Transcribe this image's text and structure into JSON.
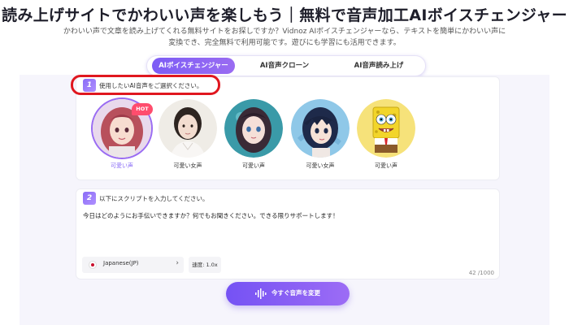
{
  "header": {
    "title": "読み上げサイトでかわいい声を楽しもう｜無料で音声加工AIボイスチェンジャー",
    "subtitle_line1": "かわいい声で文章を読み上げてくれる無料サイトをお探しですか？Vidnoz AIボイスチェンジャーなら、テキストを簡単にかわいい声に",
    "subtitle_line2": "変換でき、完全無料で利用可能です。遊びにも学習にも活用できます。"
  },
  "tabs": [
    {
      "label": "AIボイスチェンジャー",
      "active": true
    },
    {
      "label": "AI音声クローン",
      "active": false
    },
    {
      "label": "AI音声読み上げ",
      "active": false
    }
  ],
  "step1": {
    "number": "1",
    "label": "使用したいAI音声をご選択ください。"
  },
  "voices": [
    {
      "label": "可愛い声",
      "selected": true,
      "badge": "HOT"
    },
    {
      "label": "可愛い女声",
      "selected": false
    },
    {
      "label": "可愛い声",
      "selected": false
    },
    {
      "label": "可愛い女声",
      "selected": false
    },
    {
      "label": "可愛い声",
      "selected": false
    }
  ],
  "step2": {
    "number": "2",
    "label": "以下にスクリプトを入力してください。"
  },
  "script": {
    "value": "今日はどのようにお手伝いできますか？何でもお聞きください。できる限りサポートします！",
    "char_count": "42 /1000"
  },
  "language": {
    "value": "Japanese(JP)",
    "icon": "chevron-right-icon"
  },
  "speed": {
    "value": "速度: 1.0x"
  },
  "convert_button": {
    "label": "今すぐ音声を変更",
    "icon": "sound-wave-icon"
  },
  "colors": {
    "accent": "#7c5cf5",
    "highlight": "#e0171f",
    "hot": "#ff4d6d"
  }
}
